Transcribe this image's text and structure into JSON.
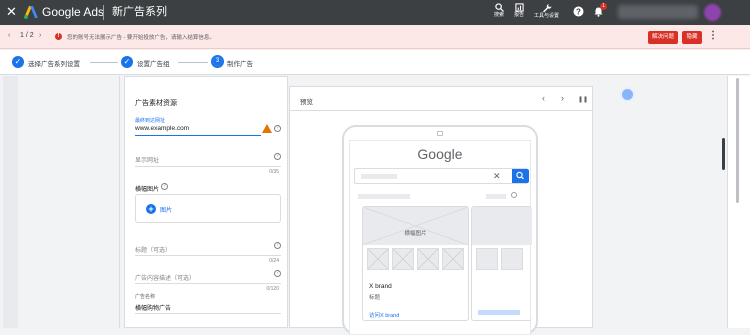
{
  "topbar": {
    "close": "✕",
    "app_name": "Google Ads",
    "campaign_title": "新广告系列",
    "tools": [
      {
        "label": "搜索",
        "icon": "search-icon"
      },
      {
        "label": "报告",
        "icon": "report-icon"
      },
      {
        "label": "工具与设置",
        "icon": "wrench-icon"
      }
    ],
    "help_icon": "help-icon",
    "notification_count": "1",
    "colors": {
      "bar": "#3c4043",
      "badge": "#d93025"
    }
  },
  "alert": {
    "prev": "‹",
    "page": "1 / 2",
    "next": "›",
    "icon": "!",
    "message": "您的账号无法展示广告 - 要开始投放广告，请输入结算信息。",
    "fix_label": "解决问题",
    "dismiss_label": "隐藏",
    "more": "⋮",
    "color": "#d93025"
  },
  "steps": [
    {
      "label": "选择广告系列设置",
      "state": "done",
      "mark": "✓"
    },
    {
      "label": "设置广告组",
      "state": "done",
      "mark": "✓"
    },
    {
      "label": "制作广告",
      "state": "current",
      "mark": "3"
    }
  ],
  "form": {
    "section_title": "广告素材资源",
    "final_url_label": "最终到达网址",
    "final_url_value": "www.example.com",
    "display_path_placeholder": "显示网址",
    "display_path_count": "0/35",
    "image_label": "横幅图片",
    "image_button": "图片",
    "headline_placeholder": "标题（可选）",
    "headline_count": "0/24",
    "description_placeholder": "广告内容描述（可选）",
    "description_count": "0/120",
    "ad_name_label": "广告名称",
    "ad_name_value": "横幅购物广告"
  },
  "preview": {
    "title": "预览",
    "prev": "‹",
    "next": "›",
    "pause": "❚❚",
    "google": "Google",
    "clear": "✕",
    "banner_label": "横幅图片",
    "brand": "X brand",
    "subtitle": "标题",
    "link": "访问X brand"
  }
}
